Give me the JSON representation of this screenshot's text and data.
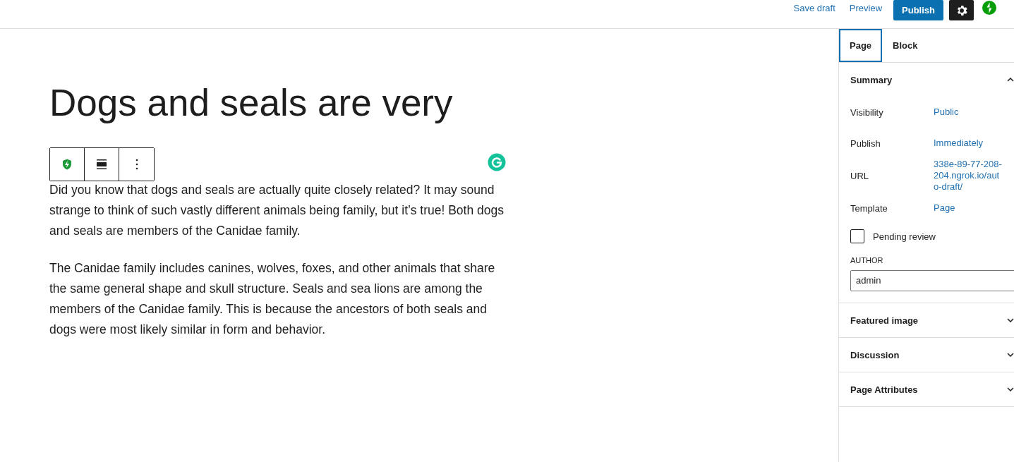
{
  "header": {
    "save_draft": "Save draft",
    "preview": "Preview",
    "publish": "Publish",
    "settings_active": true
  },
  "editor": {
    "title": "Dogs and seals are very",
    "paragraphs": [
      "Did you know that dogs and seals are actually quite closely related? It may sound strange to think of such vastly different animals being family, but it’s true! Both dogs and seals are members of the Canidae family.",
      "The Canidae family includes canines, wolves, foxes, and other animals that share the same general shape and skull structure. Seals and sea lions are among the members of the Canidae family. This is because the ancestors of both seals and dogs were most likely similar in form and behavior."
    ]
  },
  "sidebar": {
    "tabs": [
      {
        "label": "Page",
        "selected": true
      },
      {
        "label": "Block",
        "selected": false
      }
    ],
    "panels": [
      {
        "title": "Summary",
        "expanded": true
      },
      {
        "title": "Featured image",
        "expanded": false
      },
      {
        "title": "Discussion",
        "expanded": false
      },
      {
        "title": "Page Attributes",
        "expanded": false
      }
    ],
    "summary": {
      "rows": [
        {
          "label": "Visibility",
          "value": "Public"
        },
        {
          "label": "Publish",
          "value": "Immediately"
        },
        {
          "label": "URL",
          "value": "338e-89-77-208-204.ngrok.io/auto-draft/"
        },
        {
          "label": "Template",
          "value": "Page"
        }
      ],
      "pending_review": {
        "label": "Pending review",
        "checked": false
      },
      "author_label": "AUTHOR",
      "author": "admin"
    }
  }
}
